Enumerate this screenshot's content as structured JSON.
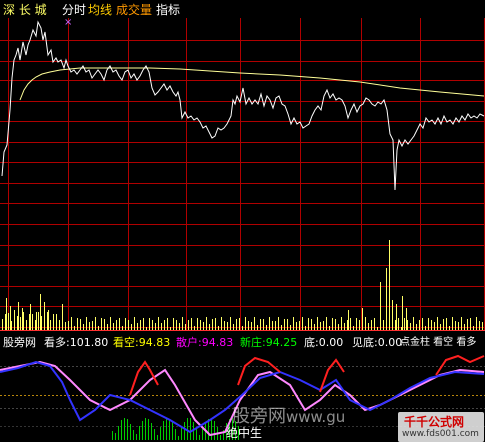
{
  "toolbar": {
    "exchange_label": "深 长 城",
    "tabs": [
      "分时",
      "均线",
      "成交量",
      "指标"
    ],
    "colors": {
      "tab_active": "#ffffff",
      "tab_gold": "#ffcc00",
      "tab_vol": "#ff9900"
    }
  },
  "indicator": {
    "name": "股旁网",
    "fields": [
      {
        "label": "看多",
        "value": "101.80",
        "color": "#ffffff"
      },
      {
        "label": "看空",
        "value": "94.83",
        "color": "#ffff00"
      },
      {
        "label": "散户",
        "value": "94.83",
        "color": "#ff00ff"
      },
      {
        "label": "新庄",
        "value": "94.25",
        "color": "#00ff00"
      },
      {
        "label": "底",
        "value": "0.00",
        "color": "#ffffff"
      },
      {
        "label": "见底",
        "value": "0.00",
        "color": "#ffffff"
      }
    ],
    "tail": "点金柱 看空 看多",
    "marker_label": "绝中生"
  },
  "watermarks": {
    "center": "股旁网",
    "center_suffix": "www.gu",
    "corner_logo": "千千公式网",
    "corner_url": "www.fds001.com"
  },
  "marker_glyph": "×",
  "colors": {
    "background": "#000000",
    "grid_red": "#b00000",
    "price_line": "#ffffff",
    "avg_line": "#ffff99",
    "volume_bars": "#ffff66",
    "kline_red": "#ff2020",
    "kline_blue": "#3333ff",
    "kline_pink": "#ff88ff",
    "green_stick": "#00cc00"
  }
}
